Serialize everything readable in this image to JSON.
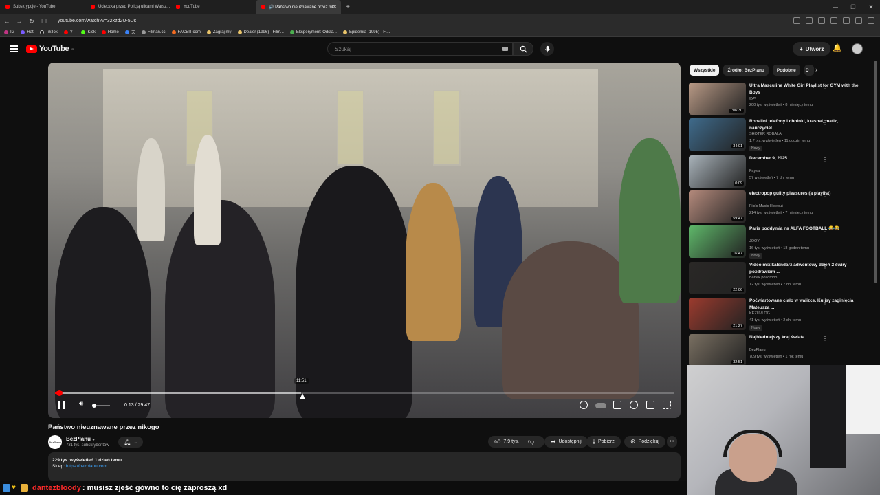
{
  "browser": {
    "tabs": [
      {
        "label": "Subskrypcje - YouTube"
      },
      {
        "label": "Ucieczka przed Policją ulicami Warsz..."
      },
      {
        "label": "YouTube"
      },
      {
        "label": "🔊 Państwo nieuznawane przez nik..."
      }
    ],
    "url": "youtube.com/watch?v=32xzd2U-5Us",
    "bookmarks": [
      "IG",
      "Rat",
      "TikTok",
      "YT",
      "Kick",
      "Home",
      "天",
      "Filman.cc",
      "FACEIT.com",
      "Zagraj.my",
      "Dealer (1996) - Film...",
      "Eksperyment: Odsła...",
      "Epidemia (1995) - Fi..."
    ]
  },
  "header": {
    "logo": "YouTube",
    "logo_region": "PL",
    "search_placeholder": "Szukaj",
    "create_label": "Utwórz"
  },
  "player": {
    "hover_time": "11:51",
    "time": "0:13 / 29:47",
    "played_fraction": 0.007,
    "buffer_fraction": 0.398
  },
  "video": {
    "title": "Państwo nieuznawane przez nikogo",
    "channel": "BezPlanu",
    "channel_avatar_text": "BezPlanu",
    "subscribers": "731 tys. subskrybentów",
    "likes": "7,9 tys.",
    "share_label": "Udostępnij",
    "download_label": "Pobierz",
    "thanks_label": "Podziękuj",
    "views_date": "229 tys. wyświetleń  1 dzień temu",
    "shop_label": "Sklep:",
    "shop_url": "https://bezplanu.com"
  },
  "chips": [
    "Wszystkie",
    "Źródło: BezPlanu",
    "Podobne",
    "D"
  ],
  "recommendations": [
    {
      "title": "Ultra Masculine White Girl Playlist for GYM with the Boys",
      "channel": "gym",
      "meta": "200 tys. wyświetleń • 8 miesięcy temu",
      "duration": "1:06:30",
      "badge": "",
      "thumb_color": "#b99a86"
    },
    {
      "title": "Robalini telefony i choinki, krasnal, matiz, nauczyciel",
      "channel": "SHOTER ROBALA",
      "meta": "1,7 tys. wyświetleń • 11 godzin temu",
      "duration": "34:01",
      "badge": "Nowy",
      "thumb_color": "#3f6b8c"
    },
    {
      "title": "December 9, 2025",
      "channel": "Faysal",
      "meta": "57 wyświetleń • 7 dni temu",
      "duration": "0:09",
      "badge": "",
      "thumb_color": "#a9b3ba"
    },
    {
      "title": "electropop guilty pleasures (a playlist)",
      "channel": "Fils's Music Hideout",
      "meta": "214 tys. wyświetleń • 7 miesięcy temu",
      "duration": "59:47",
      "badge": "",
      "thumb_color": "#b48a7c"
    },
    {
      "title": "Paris poddymia na ALFA FOOTBALL 😂😂",
      "channel": "JOOY",
      "meta": "16 tys. wyświetleń • 18 godzin temu",
      "duration": "16:47",
      "badge": "Nowy",
      "thumb_color": "#5fb86a"
    },
    {
      "title": "Video mix kalendarz adwentowy dzień 2 świry pozdrawiam ...",
      "channel": "Bartek pozdrooo",
      "meta": "12 tys. wyświetleń • 7 dni temu",
      "duration": "22:06",
      "badge": "",
      "thumb_color": "#2a2826"
    },
    {
      "title": "Poćwiartowane ciało w walizce. Kulisy zaginięcia Mateusza ...",
      "channel": "KEZUVLOG",
      "meta": "41 tys. wyświetleń • 2 dni temu",
      "duration": "21:27",
      "badge": "Nowy",
      "thumb_color": "#9c3b2e"
    },
    {
      "title": "Najbiedniejszy kraj świata",
      "channel": "BezPlanu",
      "meta": "709 tys. wyświetleń • 1 rok temu",
      "duration": "32:51",
      "badge": "",
      "thumb_color": "#7a7062"
    }
  ],
  "chat": {
    "username": "dantezbloody",
    "message": ": musisz zjeść gówno to cię zaproszą  xd"
  }
}
